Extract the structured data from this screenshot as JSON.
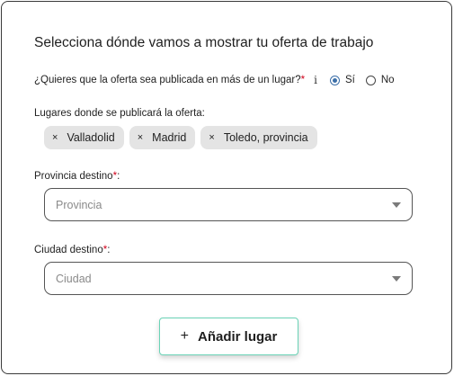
{
  "title": "Selecciona dónde vamos a mostrar tu oferta de trabajo",
  "question": {
    "text": "¿Quieres que la oferta sea publicada en más de un lugar?",
    "required_mark": "*",
    "info_glyph": "i",
    "options": [
      {
        "label": "Sí",
        "selected": true
      },
      {
        "label": "No",
        "selected": false
      }
    ]
  },
  "places": {
    "label": "Lugares donde se publicará la oferta:",
    "remove_glyph": "×",
    "chips": [
      "Valladolid",
      "Madrid",
      "Toledo, provincia"
    ]
  },
  "province": {
    "label": "Provincia destino",
    "required_mark": "*",
    "colon": ":",
    "placeholder": "Provincia"
  },
  "city": {
    "label": "Ciudad destino",
    "required_mark": "*",
    "colon": ":",
    "placeholder": "Ciudad"
  },
  "add_button": {
    "icon": "+",
    "label": "Añadir lugar"
  },
  "colors": {
    "radio_accent": "#3c6fa8",
    "required": "#d0021b",
    "button_border": "#6ad3b6",
    "chip_bg": "#e4e4e4"
  }
}
